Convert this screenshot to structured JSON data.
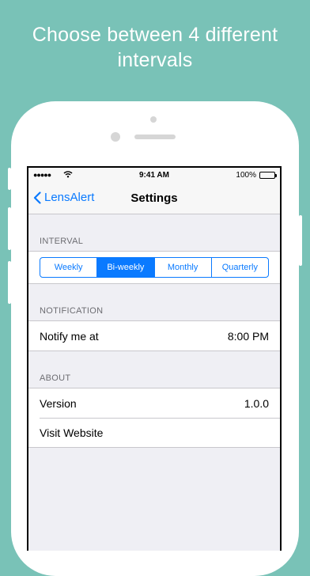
{
  "headline": {
    "line1": "Choose between 4 different",
    "line2": "intervals"
  },
  "status_bar": {
    "carrier": "●●●●●",
    "time": "9:41 AM",
    "battery": "100%",
    "battery_level": 1.0
  },
  "nav": {
    "back_label": "LensAlert",
    "title": "Settings"
  },
  "sections": {
    "interval": {
      "header": "INTERVAL",
      "options": [
        "Weekly",
        "Bi-weekly",
        "Monthly",
        "Quarterly"
      ],
      "selected": "Bi-weekly"
    },
    "notification": {
      "header": "NOTIFICATION",
      "rows": [
        {
          "label": "Notify me at",
          "value": "8:00 PM"
        }
      ]
    },
    "about": {
      "header": "ABOUT",
      "rows": [
        {
          "label": "Version",
          "value": "1.0.0"
        },
        {
          "label": "Visit Website",
          "value": ""
        }
      ]
    }
  },
  "colors": {
    "background": "#79c2b7",
    "accent": "#0a7aff",
    "table_background": "#efeff4"
  },
  "icons": {
    "back": "chevron-left-icon",
    "wifi": "wifi-icon",
    "battery": "battery-icon"
  }
}
